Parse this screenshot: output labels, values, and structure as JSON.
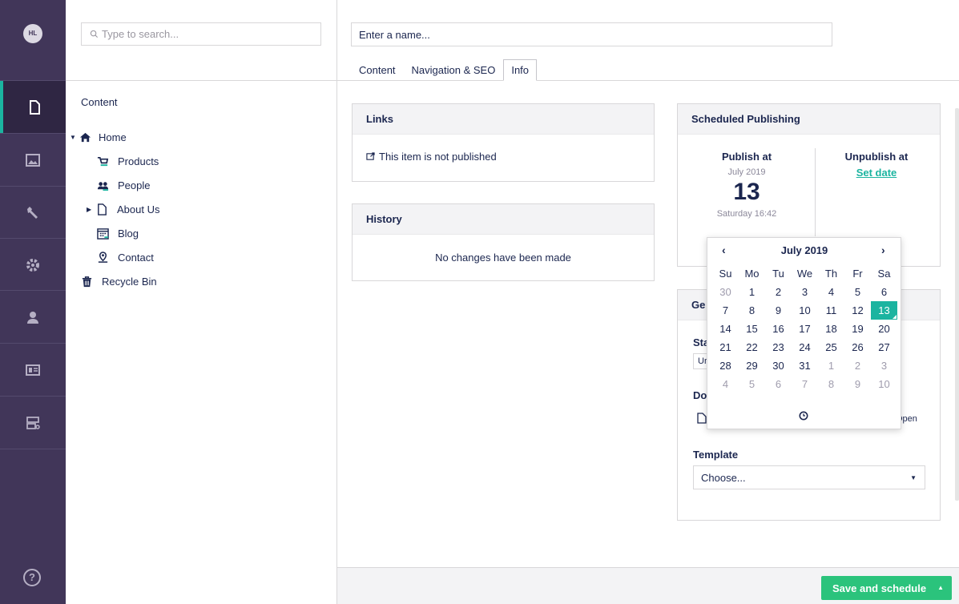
{
  "user": {
    "initials": "HL"
  },
  "tree": {
    "search_placeholder": "Type to search...",
    "section_title": "Content",
    "nodes": [
      {
        "label": "Home",
        "icon": "home-icon",
        "expanded": true
      },
      {
        "label": "Products",
        "icon": "shopping-cart-icon"
      },
      {
        "label": "People",
        "icon": "people-icon"
      },
      {
        "label": "About Us",
        "icon": "document-icon",
        "collapsed": true
      },
      {
        "label": "Blog",
        "icon": "calendar-icon"
      },
      {
        "label": "Contact",
        "icon": "map-pin-icon"
      },
      {
        "label": "Recycle Bin",
        "icon": "trash-icon"
      }
    ]
  },
  "editor": {
    "name_placeholder": "Enter a name...",
    "tabs": [
      "Content",
      "Navigation & SEO",
      "Info"
    ],
    "active_tab": "Info"
  },
  "links": {
    "title": "Links",
    "status": "This item is not published"
  },
  "history": {
    "title": "History",
    "empty_text": "No changes have been made"
  },
  "scheduled": {
    "title": "Scheduled Publishing",
    "publish_label": "Publish at",
    "publish_month": "July 2019",
    "publish_day": "13",
    "publish_time": "Saturday 16:42",
    "unpublish_label": "Unpublish at",
    "unpublish_link": "Set date"
  },
  "general": {
    "title_fragment": "Ge",
    "status_fragment": "Sta",
    "status_value_fragment": "Ur",
    "doc_fragment": "Do",
    "open_fragment": "Open",
    "template_label": "Template",
    "template_value": "Choose..."
  },
  "datepicker": {
    "prev": "‹",
    "next": "›",
    "title": "July 2019",
    "weekdays": [
      "Su",
      "Mo",
      "Tu",
      "We",
      "Th",
      "Fr",
      "Sa"
    ],
    "weeks": [
      [
        "30",
        "1",
        "2",
        "3",
        "4",
        "5",
        "6"
      ],
      [
        "7",
        "8",
        "9",
        "10",
        "11",
        "12",
        "13"
      ],
      [
        "14",
        "15",
        "16",
        "17",
        "18",
        "19",
        "20"
      ],
      [
        "21",
        "22",
        "23",
        "24",
        "25",
        "26",
        "27"
      ],
      [
        "28",
        "29",
        "30",
        "31",
        "1",
        "2",
        "3"
      ],
      [
        "4",
        "5",
        "6",
        "7",
        "8",
        "9",
        "10"
      ]
    ],
    "selected": "13"
  },
  "footer": {
    "save_label": "Save and schedule"
  },
  "colors": {
    "rail": "#413659",
    "accent": "#1bb4a0",
    "save": "#2bc37c"
  }
}
